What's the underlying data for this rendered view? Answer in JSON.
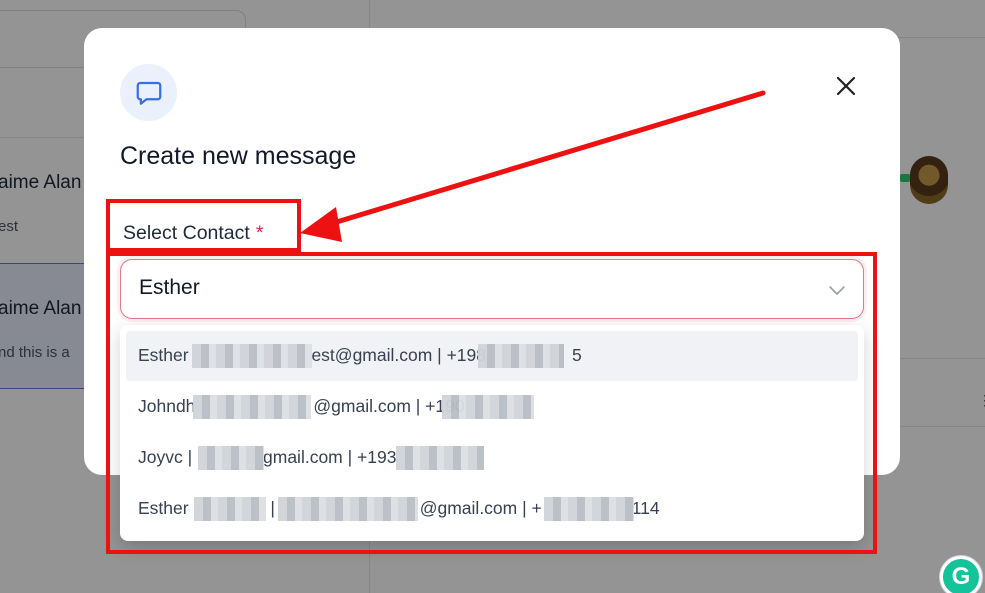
{
  "background": {
    "items": [
      {
        "title": "aime Alan",
        "snippet": "est"
      },
      {
        "title": "aime Alan",
        "snippet": "nd this is a"
      }
    ]
  },
  "modal": {
    "icon": "message-bubble-icon",
    "title": "Create new message",
    "close_icon": "close-icon",
    "field": {
      "label": "Select Contact",
      "required_mark": "*",
      "value": "Esther",
      "chevron_icon": "chevron-down-icon"
    }
  },
  "dropdown": {
    "options": [
      {
        "pre": "Esther ",
        "mid": "est@gmail.com | +198",
        "post": "5"
      },
      {
        "pre": "Johndh",
        "mid": "@gmail.com | +190",
        "post": ""
      },
      {
        "pre": "Joyvc | ",
        "mid": "gmail.com | +193",
        "post": ""
      },
      {
        "pre": "Esther ",
        "mid": " | ",
        "post": "@gmail.com | +",
        "tail": "114"
      }
    ]
  },
  "annotations": {
    "color": "#ee1111"
  },
  "grammarly": {
    "label": "G"
  }
}
